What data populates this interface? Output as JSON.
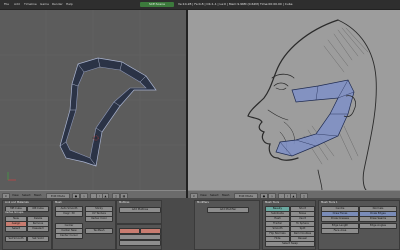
{
  "menubar": {
    "items": [
      "File",
      "Add",
      "Timeline",
      "Game",
      "Render",
      "Help"
    ],
    "scene": "SCE:Scene",
    "stats": "Ve:10-28 | Fa:0-8 | Ob:1-1 | La:0 | Mem:9.96M (0.62M) Time:00:00.00 | Cube"
  },
  "left_viewport": {
    "header_buttons": [
      "View",
      "Select",
      "Mesh",
      "Edit Mode"
    ],
    "colors": {
      "bg": "#5c5c5c",
      "mesh": "#2b3346",
      "mesh_edge": "#c8d0e8",
      "cursor": "#d04040"
    }
  },
  "right_viewport": {
    "header_buttons": [
      "View",
      "Select",
      "Mesh",
      "Edit Mode"
    ],
    "colors": {
      "bg": "#9d9d9d",
      "mesh_fill": "#7f90c8",
      "sketch": "#2a2a2a"
    }
  },
  "panel": {
    "sections": [
      {
        "label": "Link and Materials",
        "buttons": [
          "ME:Cube",
          "OB:Cube",
          "Vertex Groups",
          "New",
          "Delete",
          "Assign",
          "Remove",
          "Select",
          "Deselect",
          "Set Smooth",
          "Set Solid"
        ]
      },
      {
        "label": "Mesh",
        "buttons": [
          "Auto Smooth",
          "Degr: 30",
          "Sticky",
          "UV Texture",
          "Vertex Color",
          "Center",
          "Center New",
          "Center Cursor",
          "TexMesh"
        ]
      },
      {
        "label": "Multires",
        "buttons": [
          "Add Multires"
        ]
      },
      {
        "label": "Modifiers",
        "buttons": [
          "Add Modifier"
        ]
      },
      {
        "label": "Mesh Tools",
        "buttons": [
          "Beauty",
          "Short",
          "Subdivide",
          "Noise",
          "Hash",
          "Xsort",
          "Fractal",
          "To Sphere",
          "Smooth",
          "Split",
          "Flip Normals",
          "Rem Doubles",
          "Hide",
          "Reveal",
          "Select Swap"
        ]
      },
      {
        "label": "Mesh Tools 1",
        "buttons": [
          "Centre",
          "Normals",
          "Draw Faces",
          "Draw Edges",
          "Draw Creases",
          "Draw Seams",
          "Edge Length",
          "Edge Angles",
          "Face Area"
        ]
      }
    ]
  }
}
